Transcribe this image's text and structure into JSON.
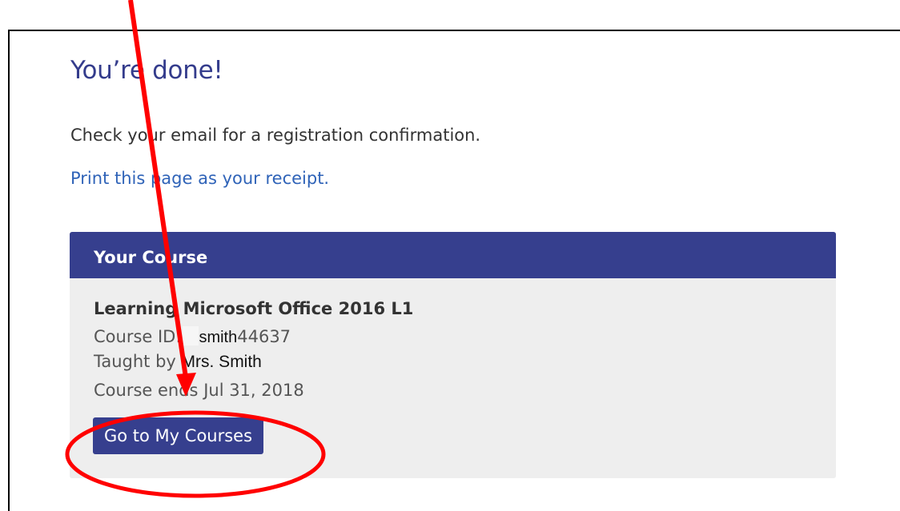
{
  "confirmation": {
    "heading": "You’re done!",
    "instruction": "Check your email for a registration confirmation.",
    "print_link": "Print this page as your receipt."
  },
  "course_panel": {
    "header": "Your Course",
    "course_title": "Learning Microsoft Office 2016 L1",
    "course_id_label": "Course ID:",
    "course_id_prefix": "smith",
    "course_id_number": "44637",
    "taught_by_label": "Taught by",
    "teacher": "Mrs. Smith",
    "course_ends_label": "Course ends",
    "course_end_date": "Jul 31, 2018",
    "button_label": "Go to My Courses"
  },
  "annotation": {
    "color": "#ff0000",
    "shapes": [
      "arrow",
      "ellipse"
    ]
  }
}
